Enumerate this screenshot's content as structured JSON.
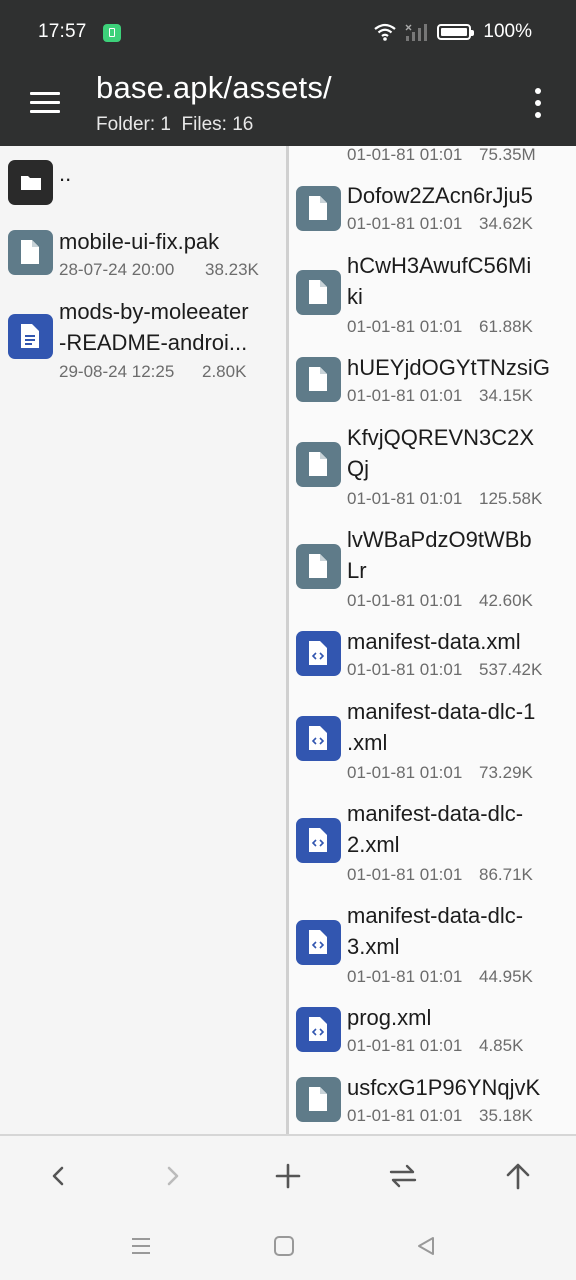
{
  "status": {
    "time": "17:57",
    "battery": "100%"
  },
  "appbar": {
    "title": "base.apk/assets/",
    "subtitle": "Folder: 1  Files: 16"
  },
  "left_pane": {
    "parent": "..",
    "items": [
      {
        "name": "mobile-ui-fix.pak",
        "date": "28-07-24 20:00",
        "size": "38.23K"
      },
      {
        "name_line1": "mods-by-moleeater",
        "name_line2": "-README-androi...",
        "date": "29-08-24 12:25",
        "size": "2.80K"
      }
    ]
  },
  "right_pane": {
    "partial": {
      "date": "01-01-81 01:01",
      "size": "75.35M"
    },
    "items": [
      {
        "name": "Dofow2ZAcn6rJju5",
        "date": "01-01-81 01:01",
        "size": "34.62K"
      },
      {
        "name_line1": "hCwH3AwufC56Mi",
        "name_line2": "ki",
        "date": "01-01-81 01:01",
        "size": "61.88K"
      },
      {
        "name": "hUEYjdOGYtTNzsiG",
        "date": "01-01-81 01:01",
        "size": "34.15K"
      },
      {
        "name_line1": "KfvjQQREVN3C2X",
        "name_line2": "Qj",
        "date": "01-01-81 01:01",
        "size": "125.58K"
      },
      {
        "name_line1": "lvWBaPdzO9tWBb",
        "name_line2": "Lr",
        "date": "01-01-81 01:01",
        "size": "42.60K"
      },
      {
        "name": "manifest-data.xml",
        "date": "01-01-81 01:01",
        "size": "537.42K"
      },
      {
        "name_line1": "manifest-data-dlc-1",
        "name_line2": ".xml",
        "date": "01-01-81 01:01",
        "size": "73.29K"
      },
      {
        "name_line1": "manifest-data-dlc-",
        "name_line2": "2.xml",
        "date": "01-01-81 01:01",
        "size": "86.71K"
      },
      {
        "name_line1": "manifest-data-dlc-",
        "name_line2": "3.xml",
        "date": "01-01-81 01:01",
        "size": "44.95K"
      },
      {
        "name": "prog.xml",
        "date": "01-01-81 01:01",
        "size": "4.85K"
      },
      {
        "name": "usfcxG1P96YNqjvK",
        "date": "01-01-81 01:01",
        "size": "35.18K"
      }
    ]
  },
  "colors": {
    "appbar": "#2f3030",
    "generic_file_icon": "#5f7b89",
    "xml_file_icon": "#3256b0",
    "folder_icon": "#2a2a2a"
  },
  "icons": [
    "menu-icon",
    "more-icon",
    "folder-icon",
    "file-icon",
    "doc-icon",
    "xml-icon",
    "back-icon",
    "forward-icon",
    "add-icon",
    "swap-icon",
    "up-icon"
  ]
}
